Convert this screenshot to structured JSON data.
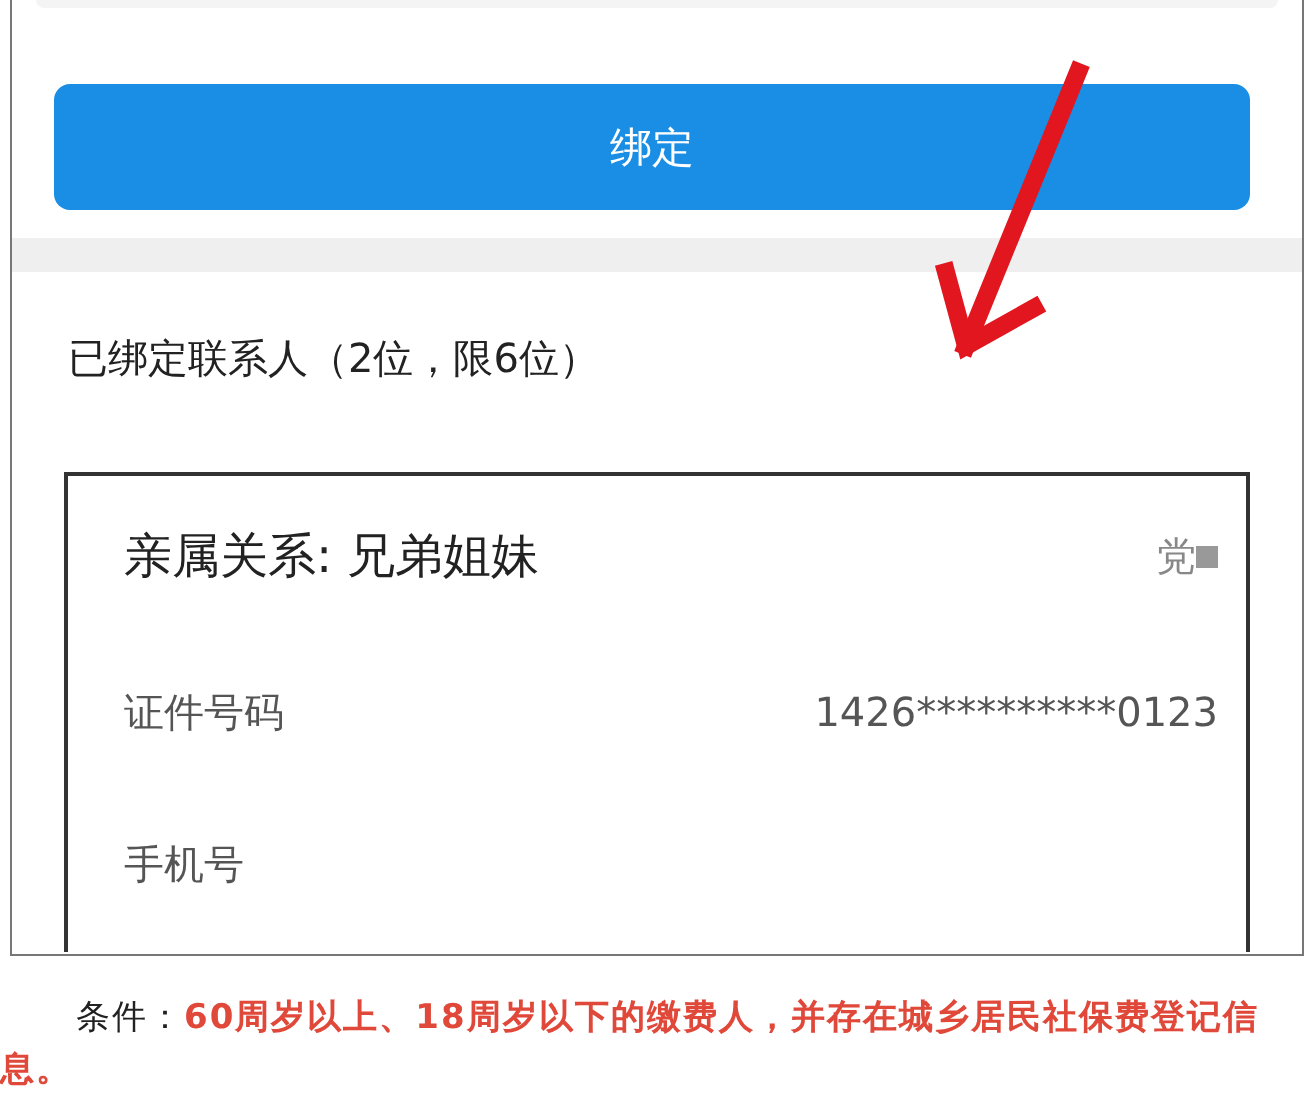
{
  "bind_button": {
    "label": "绑定"
  },
  "section_title": "已绑定联系人（2位，限6位）",
  "contact_card": {
    "relation": "亲属关系: 兄弟姐妹",
    "status": "党",
    "rows": [
      {
        "label": "证件号码",
        "value": "1426**********0123"
      },
      {
        "label": "手机号"
      }
    ]
  },
  "caption": "条件：**60周岁以上、18周岁以下的缴费人，并存在城乡居民社保费登记信息。**"
}
